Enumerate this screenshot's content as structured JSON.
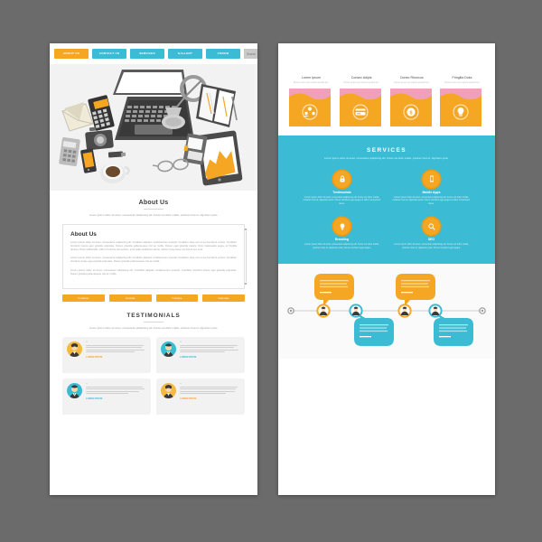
{
  "meta": {
    "background_color": "#6b6b6b",
    "page_background": "#ffffff",
    "accent_orange": "#f5a623",
    "accent_teal": "#3bbcd4",
    "muted_text": "#9b9b9b"
  },
  "left_page": {
    "nav": {
      "items": [
        {
          "label": "ABOUT US",
          "active": true
        },
        {
          "label": "CONTACT US",
          "active": false
        },
        {
          "label": "SERVICES",
          "active": false
        },
        {
          "label": "GALLERY",
          "active": false
        },
        {
          "label": "FORUM",
          "active": false
        }
      ],
      "search_placeholder": "Search",
      "search_icon": "search-icon"
    },
    "hero": {
      "illustration_name": "flat-desk-workspace-illustration",
      "items": [
        "laptop",
        "desk-lamp",
        "notebook",
        "tablet",
        "camera",
        "calculator",
        "smartphone",
        "coffee-cup",
        "eyeglasses",
        "envelope",
        "usb-drive",
        "diary"
      ]
    },
    "about": {
      "title": "About Us",
      "lede": "Lorem ipsum dolor sit amet, consectetur adipiscing elit. Fusce vel dolor mattis, pulvinar risus id, dignissim justo.",
      "card_title": "About Us",
      "paragraph_1": "Lorem ipsum dolor sit amet, consectetur adipiscing elit. Curabitur aliquam condimentum suscipit. Curabitur vitae orci et leo hendrerit cursus. Curabitur tincidunt metus eget gravida vulputate. Donec gravida pellentesque nisl ac mollis. Donec eget gravida mauris. Duis malesuada augue ut fringilla ultrices. Proin sollicitudin, nibh in rhoncus fermentum, eros nulla vestibulum lacus, varius consectetur est lectus nec eros.",
      "paragraph_2": "Lorem ipsum dolor sit amet, consectetur adipiscing elit. Curabitur aliquam condimentum suscipit. Curabitur vitae orci et leo hendrerit cursus. Curabitur tincidunt metus eget gravida vulputate. Donec gravida pellentesque nisl ac mollis.",
      "paragraph_3": "Lorem ipsum dolor sit amet, consectetur adipiscing elit. Curabitur aliquam condimentum suscipit. Curabitur tincidunt metus eget gravida vulputate. Donec gravida pellentesque nisl ac mollis.",
      "buttons": [
        "Curabitur",
        "Gravida",
        "Tristique",
        "Vulputate"
      ]
    },
    "testimonials": {
      "title": "TESTIMONIALS",
      "lede": "Lorem ipsum dolor sit amet, consectetur adipiscing elit. Fusce vel dolor mattis, pulvinar risus id, dignissim justo.",
      "cards": [
        {
          "avatar": "avatar-female-orange",
          "accent": "or",
          "name": "LOREM IPSUM"
        },
        {
          "avatar": "avatar-male-teal",
          "accent": "te",
          "name": "LOREM IPSUM"
        },
        {
          "avatar": "avatar-male-teal",
          "accent": "te",
          "name": "LOREM IPSUM"
        },
        {
          "avatar": "avatar-female-orange",
          "accent": "or",
          "name": "LOREM IPSUM"
        }
      ]
    }
  },
  "right_page": {
    "features": [
      {
        "title": "Lorem Ipsum",
        "sub": "Donec et leo nec mauris suscipit leo.",
        "icon": "users-group-icon"
      },
      {
        "title": "Consec Adipis",
        "sub": "Donec et leo nec mauris suscipit leo.",
        "icon": "credit-card-icon"
      },
      {
        "title": "Donec Rhoncus",
        "sub": "Donec et leo nec mauris suscipit leo.",
        "icon": "coin-dollar-icon"
      },
      {
        "title": "Fringilla Dolor",
        "sub": "Donec et leo nec mauris suscipit leo.",
        "icon": "lightbulb-icon"
      }
    ],
    "services": {
      "title": "SERVICES",
      "lede": "Lorem ipsum dolor sit amet, consectetur adipiscing elit. Fusce vel dolor mattis, pulvinar risus id, dignissim justo.",
      "items": [
        {
          "name": "Testimonials",
          "icon": "lock-icon",
          "desc": "Lorem ipsum dolor sit amet, consectetur adipiscing elit. Fusce vel dolor mattis, pulvinar risus id, dignissim justo. Donec tincidunt eget augue et dolor consectetur lacus."
        },
        {
          "name": "Mobile Apps",
          "icon": "mobile-phone-icon",
          "desc": "Lorem ipsum dolor sit amet, consectetur adipiscing elit. Fusce vel dolor mattis, pulvinar risus id, dignissim justo. Donec tincidunt eget augue et dolor consectetur lacus."
        },
        {
          "name": "Branding",
          "icon": "lightbulb-icon",
          "desc": "Lorem ipsum dolor sit amet, consectetur adipiscing elit. Fusce vel dolor mattis, pulvinar risus id, dignissim justo. Donec tincidunt eget augue."
        },
        {
          "name": "SEO",
          "icon": "magnifier-icon",
          "desc": "Lorem ipsum dolor sit amet, consectetur adipiscing elit. Fusce vel dolor mattis, pulvinar risus id, dignissim justo. Donec tincidunt eget augue."
        }
      ]
    },
    "timeline": {
      "nodes": [
        {
          "avatar": "avatar-male-orange",
          "ring": "#f5a623",
          "bubble_position": "top",
          "bubble_color": "#f5a623",
          "bubble_text": "Lorem ipsum dolor sit amet, consectetur adipiscing elit. Fusce vel dolor mattis.",
          "bubble_label": "Lorem Ipsum"
        },
        {
          "avatar": "avatar-male-teal",
          "ring": "#3bbcd4",
          "bubble_position": "bottom",
          "bubble_color": "#3bbcd4",
          "bubble_text": "Lorem ipsum dolor sit amet, consectetur adipiscing elit. Fusce vel dolor mattis.",
          "bubble_label": "Lorem Ipsum"
        },
        {
          "avatar": "avatar-male-orange",
          "ring": "#f5a623",
          "bubble_position": "top",
          "bubble_color": "#f5a623",
          "bubble_text": "Lorem ipsum dolor sit amet, consectetur adipiscing elit. Fusce vel dolor mattis.",
          "bubble_label": "Lorem Ipsum"
        },
        {
          "avatar": "avatar-male-teal",
          "ring": "#3bbcd4",
          "bubble_position": "bottom",
          "bubble_color": "#3bbcd4",
          "bubble_text": "Lorem ipsum dolor sit amet, consectetur adipiscing elit. Fusce vel dolor mattis.",
          "bubble_label": "Lorem Ipsum"
        }
      ]
    }
  }
}
